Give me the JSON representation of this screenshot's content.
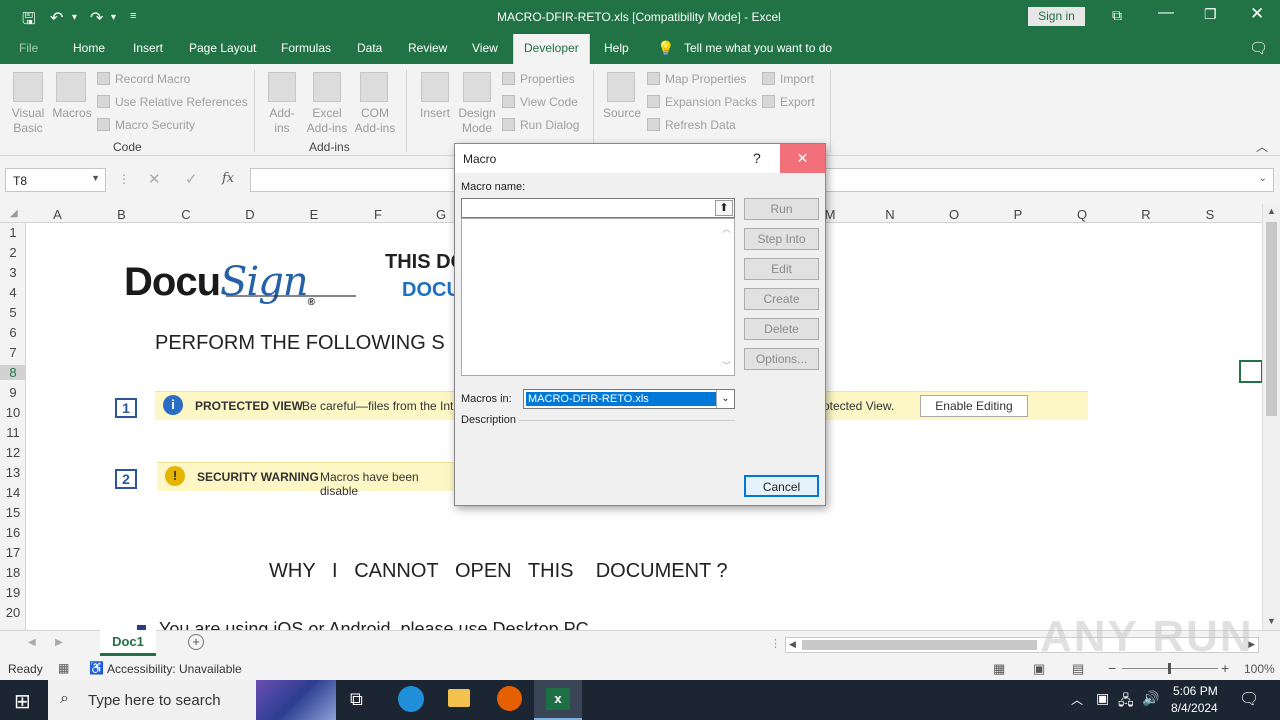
{
  "titlebar": {
    "title": "MACRO-DFIR-RETO.xls  [Compatibility Mode]  -  Excel",
    "signin": "Sign in"
  },
  "ribbon_tabs": [
    "File",
    "Home",
    "Insert",
    "Page Layout",
    "Formulas",
    "Data",
    "Review",
    "View",
    "Developer",
    "Help"
  ],
  "tell_me": "Tell me what you want to do",
  "ribbon": {
    "visual_basic": "Visual Basic",
    "macros": "Macros",
    "record_macro": "Record Macro",
    "use_relative": "Use Relative References",
    "macro_security": "Macro Security",
    "group_code": "Code",
    "addins": "Add-ins",
    "excel_addins": "Excel Add-ins",
    "com_addins": "COM Add-ins",
    "group_addins": "Add-ins",
    "insert": "Insert",
    "design_mode": "Design Mode",
    "properties": "Properties",
    "view_code": "View Code",
    "run_dialog": "Run Dialog",
    "source": "Source",
    "map_properties": "Map Properties",
    "expansion_packs": "Expansion Packs",
    "refresh_data": "Refresh Data",
    "import": "Import",
    "export": "Export"
  },
  "formula_bar": {
    "namebox": "T8",
    "fx": "fx"
  },
  "columns": [
    "A",
    "B",
    "C",
    "D",
    "E",
    "F",
    "G",
    "M",
    "N",
    "O",
    "P",
    "Q",
    "R",
    "S"
  ],
  "rows": [
    "1",
    "2",
    "3",
    "4",
    "5",
    "6",
    "7",
    "8",
    "9",
    "10",
    "11",
    "12",
    "13",
    "14",
    "15",
    "16",
    "17",
    "18",
    "19",
    "20"
  ],
  "sheet": {
    "logo_docu": "Docu",
    "logo_sign": "Sign",
    "title1": "THIS DO",
    "title2": "DOCU",
    "perform": "PERFORM  THE  FOLLOWING  S",
    "step1": "1",
    "pv_title": "PROTECTED VIEW",
    "pv_text": "Be careful—files from the Int",
    "pv_text2": "rotected View.",
    "enable_editing": "Enable Editing",
    "step2": "2",
    "sw_title": "SECURITY WARNING",
    "sw_text": "Macros have been disable",
    "why": "WHY   I   CANNOT   OPEN   THIS    DOCUMENT ?",
    "bullet": "You are using iOS or Android, please use Desktop PC"
  },
  "sheet_tab": "Doc1",
  "status": {
    "ready": "Ready",
    "accessibility": "Accessibility: Unavailable",
    "zoom": "100%"
  },
  "dialog": {
    "title": "Macro",
    "help": "?",
    "macro_name_label": "Macro name:",
    "run": "Run",
    "step_into": "Step Into",
    "edit": "Edit",
    "create": "Create",
    "delete": "Delete",
    "options": "Options...",
    "macros_in_label": "Macros in:",
    "macros_in_value": "MACRO-DFIR-RETO.xls",
    "description_label": "Description",
    "cancel": "Cancel"
  },
  "taskbar": {
    "search_placeholder": "Type here to search",
    "time": "5:06 PM",
    "date": "8/4/2024"
  },
  "watermark": "ANY RUN",
  "colors": {
    "excel_green": "#217346",
    "dialog_close": "#e81123"
  }
}
